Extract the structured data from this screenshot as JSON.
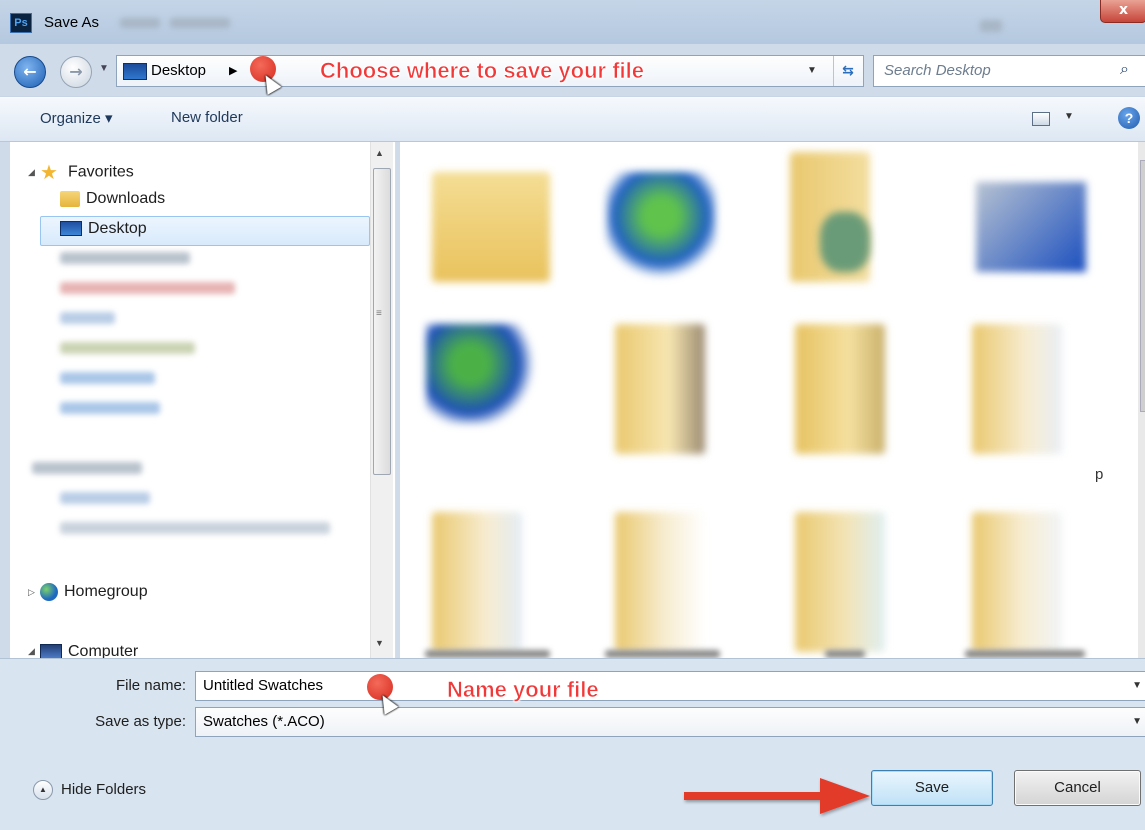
{
  "window": {
    "title": "Save As",
    "app_icon": "Ps",
    "close": "x"
  },
  "nav": {
    "back_icon": "←",
    "forward_icon": "→",
    "recent_icon": "▼",
    "address": "Desktop",
    "address_sep": "▶",
    "address_drop": "▼",
    "refresh": "⇆",
    "search_placeholder": "Search Desktop",
    "search_icon": "⌕"
  },
  "annotations": {
    "location_hint": "Choose where to save your file",
    "name_hint": "Name your file"
  },
  "toolbar": {
    "organize": "Organize ▾",
    "new_folder": "New folder",
    "view_drop": "▼",
    "help": "?"
  },
  "sidebar": {
    "favorites": "Favorites",
    "downloads": "Downloads",
    "desktop": "Desktop",
    "homegroup": "Homegroup",
    "computer": "Computer",
    "expanded": "◢",
    "collapsed": "▷"
  },
  "content": {
    "partial_label_suffix": "p",
    "items": [
      "",
      "",
      "",
      "",
      "",
      "",
      "",
      "",
      "",
      "",
      "",
      ""
    ]
  },
  "form": {
    "file_name_label": "File name:",
    "file_name_value": "Untitled Swatches",
    "save_type_label": "Save as type:",
    "save_type_value": "Swatches (*.ACO)",
    "drop": "▼"
  },
  "footer": {
    "hide_folders": "Hide Folders",
    "hide_arrow": "▲",
    "save": "Save",
    "cancel": "Cancel"
  },
  "colors": {
    "annotation_red": "#f2393a",
    "selection_blue": "#99c6f1"
  }
}
